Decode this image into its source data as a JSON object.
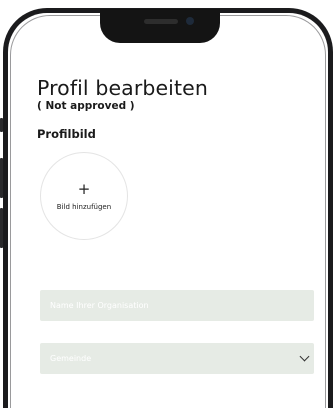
{
  "header": {
    "title": "Profil bearbeiten",
    "status": "( Not approved )"
  },
  "profile_image": {
    "section_label": "Profilbild",
    "add_symbol": "+",
    "add_label": "Bild hinzufügen"
  },
  "form": {
    "organisation_placeholder": "Name Ihrer Organisation",
    "gemeinde_placeholder": "Gemeinde"
  },
  "icons": {
    "add": "plus-icon",
    "select": "chevron-down-icon"
  },
  "colors": {
    "field_background": "#e6ebe5",
    "frame": "#1b1b1d"
  }
}
